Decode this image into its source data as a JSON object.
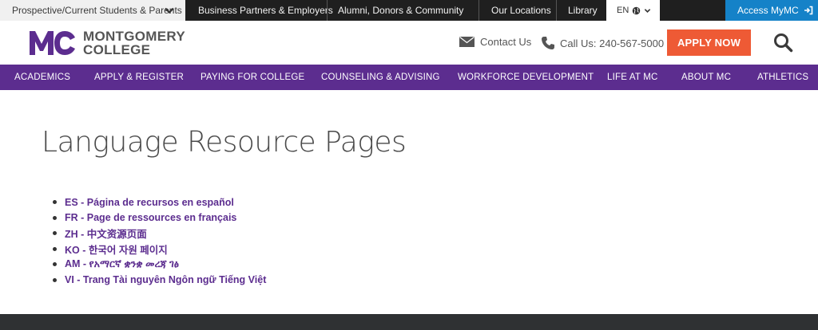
{
  "topbar": {
    "audience_label": "Prospective/Current Students & Parents",
    "links": [
      {
        "label": "Business Partners & Employers"
      },
      {
        "label": "Alumni, Donors & Community"
      },
      {
        "label": "Our Locations"
      },
      {
        "label": "Library"
      }
    ],
    "language": "EN",
    "access_label": "Access MyMC"
  },
  "header": {
    "logo_line1": "MONTGOMERY",
    "logo_line2": "COLLEGE",
    "contact_label": "Contact Us",
    "call_label": "Call Us: 240-567-5000",
    "apply_label": "APPLY NOW"
  },
  "nav": {
    "items": [
      {
        "label": "ACADEMICS"
      },
      {
        "label": "APPLY & REGISTER"
      },
      {
        "label": "PAYING FOR COLLEGE"
      },
      {
        "label": "COUNSELING & ADVISING"
      },
      {
        "label": "WORKFORCE DEVELOPMENT"
      },
      {
        "label": "LIFE AT MC"
      },
      {
        "label": "ABOUT MC"
      },
      {
        "label": "ATHLETICS"
      }
    ]
  },
  "main": {
    "title": "Language Resource Pages",
    "languages": [
      {
        "label": "ES - Página de recursos en español"
      },
      {
        "label": "FR - Page de ressources en français"
      },
      {
        "label": "ZH - 中文资源页面"
      },
      {
        "label": "KO - 한국어 자원 페이지"
      },
      {
        "label": "AM - የአማርኛ ቋንቋ መረጃ ገፅ"
      },
      {
        "label": "VI - Trang Tài nguyên Ngôn ngữ Tiếng Việt"
      }
    ]
  },
  "colors": {
    "brand_purple": "#5c2d8f",
    "apply_orange": "#ee5a35",
    "access_blue": "#1582c8",
    "topbar_dark": "#1f1f1f"
  }
}
